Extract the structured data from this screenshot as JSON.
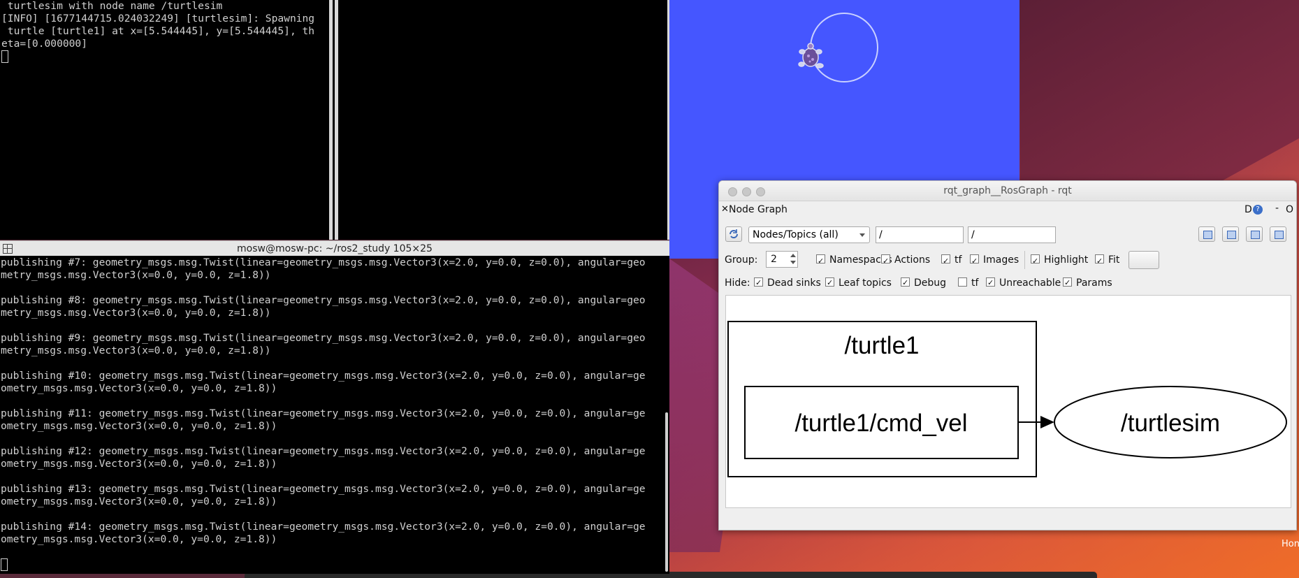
{
  "terminal_top_left": {
    "lines": [
      " turtlesim with node name /turtlesim",
      "[INFO] [1677144715.024032249] [turtlesim]: Spawning",
      " turtle [turtle1] at x=[5.544445], y=[5.544445], th",
      "eta=[0.000000]"
    ]
  },
  "terminal_bottom": {
    "title": "mosw@mosw-pc: ~/ros2_study 105×25",
    "lines": [
      "publishing #7: geometry_msgs.msg.Twist(linear=geometry_msgs.msg.Vector3(x=2.0, y=0.0, z=0.0), angular=geo",
      "metry_msgs.msg.Vector3(x=0.0, y=0.0, z=1.8))",
      "publishing #8: geometry_msgs.msg.Twist(linear=geometry_msgs.msg.Vector3(x=2.0, y=0.0, z=0.0), angular=geo",
      "metry_msgs.msg.Vector3(x=0.0, y=0.0, z=1.8))",
      "publishing #9: geometry_msgs.msg.Twist(linear=geometry_msgs.msg.Vector3(x=2.0, y=0.0, z=0.0), angular=geo",
      "metry_msgs.msg.Vector3(x=0.0, y=0.0, z=1.8))",
      "publishing #10: geometry_msgs.msg.Twist(linear=geometry_msgs.msg.Vector3(x=2.0, y=0.0, z=0.0), angular=ge",
      "ometry_msgs.msg.Vector3(x=0.0, y=0.0, z=1.8))",
      "publishing #11: geometry_msgs.msg.Twist(linear=geometry_msgs.msg.Vector3(x=2.0, y=0.0, z=0.0), angular=ge",
      "ometry_msgs.msg.Vector3(x=0.0, y=0.0, z=1.8))",
      "publishing #12: geometry_msgs.msg.Twist(linear=geometry_msgs.msg.Vector3(x=2.0, y=0.0, z=0.0), angular=ge",
      "ometry_msgs.msg.Vector3(x=0.0, y=0.0, z=1.8))",
      "publishing #13: geometry_msgs.msg.Twist(linear=geometry_msgs.msg.Vector3(x=2.0, y=0.0, z=0.0), angular=ge",
      "ometry_msgs.msg.Vector3(x=0.0, y=0.0, z=1.8))",
      "publishing #14: geometry_msgs.msg.Twist(linear=geometry_msgs.msg.Vector3(x=2.0, y=0.0, z=0.0), angular=ge",
      "ometry_msgs.msg.Vector3(x=0.0, y=0.0, z=1.8))"
    ]
  },
  "turtlesim": {
    "background": "#4556ff",
    "icon": "turtle-icon"
  },
  "rqt": {
    "title": "rqt_graph__RosGraph - rqt",
    "plugin_name": "Node Graph",
    "header_d": "D",
    "header_help": "?",
    "header_minus": "-",
    "header_o": "O",
    "toolbar": {
      "mode": "Nodes/Topics (all)",
      "filter1": "/",
      "filter2": "/"
    },
    "options": {
      "group_label": "Group:",
      "group_value": "2",
      "namespaces_label": "Namespaces",
      "actions_label": "Actions",
      "tf_label": "tf",
      "images_label": "Images",
      "highlight_label": "Highlight",
      "fit_label": "Fit"
    },
    "hide": {
      "label": "Hide:",
      "dead_sinks": "Dead sinks",
      "leaf_topics": "Leaf topics",
      "debug": "Debug",
      "tf": "tf",
      "unreachable": "Unreachable",
      "params": "Params"
    },
    "graph": {
      "namespace": "/turtle1",
      "topic": "/turtle1/cmd_vel",
      "node": "/turtlesim"
    }
  },
  "desktop": {
    "label": "Hon"
  }
}
